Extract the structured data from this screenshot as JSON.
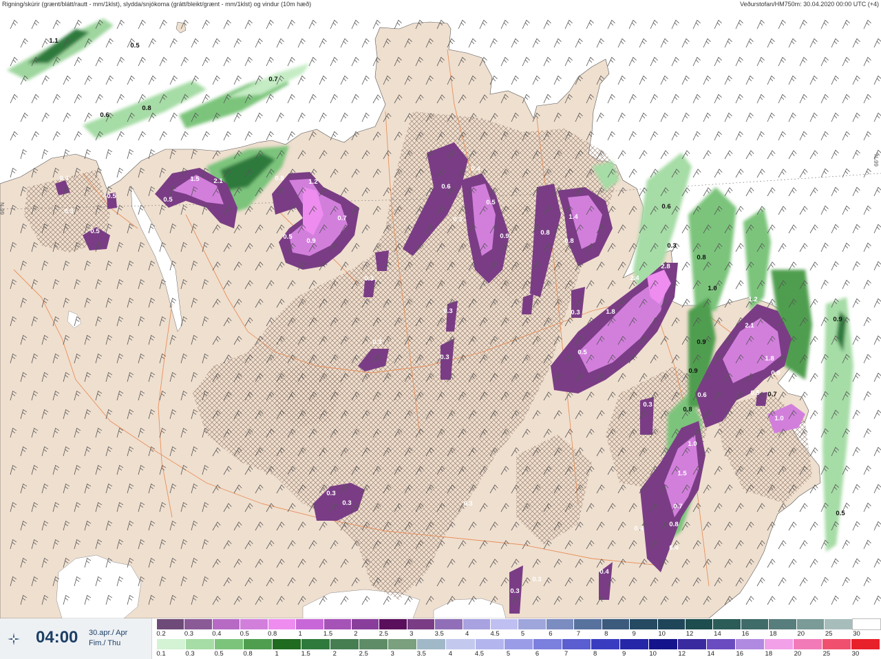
{
  "header": {
    "title": "Rigning/skúrir (grænt/blátt/rautt - mm/1klst), slydda/snjókoma (grátt/bleikt/grænt - mm/1klst) og vindur (10m hæð)",
    "source": "Veðurstofan/HM750m: 30.04.2020 00:00 UTC (+4)"
  },
  "time_panel": {
    "icon": "compass-spinner-icon",
    "time": "04:00",
    "date_line1": "30.apr./ Apr",
    "date_line2": "Fim./ Thu"
  },
  "map": {
    "land_color": "#efdfcf",
    "sea_color": "#ffffff",
    "road_color": "#e8905a",
    "latitude_label": "66°N",
    "precip_labels": [
      {
        "text": "1.1"
      },
      {
        "text": "0.5"
      },
      {
        "text": "0.7"
      },
      {
        "text": "0.8"
      },
      {
        "text": "0.6"
      },
      {
        "text": "0.4"
      },
      {
        "text": "0.5"
      },
      {
        "text": "0.3"
      },
      {
        "text": "0.5"
      },
      {
        "text": "1.5"
      },
      {
        "text": "2.1"
      },
      {
        "text": "0.5"
      },
      {
        "text": "1.2"
      },
      {
        "text": "0.8"
      },
      {
        "text": "0.7"
      },
      {
        "text": "0.5"
      },
      {
        "text": "0.9"
      },
      {
        "text": "0.6"
      },
      {
        "text": "0.4"
      },
      {
        "text": "0.3"
      },
      {
        "text": "0.5"
      },
      {
        "text": "0.9"
      },
      {
        "text": "0.8"
      },
      {
        "text": "1.4"
      },
      {
        "text": "0.8"
      },
      {
        "text": "0.6"
      },
      {
        "text": "0.3"
      },
      {
        "text": "2.4"
      },
      {
        "text": "2.8"
      },
      {
        "text": "1.8"
      },
      {
        "text": "0.3"
      },
      {
        "text": "0.5"
      },
      {
        "text": "0.8"
      },
      {
        "text": "1.0"
      },
      {
        "text": "0.9"
      },
      {
        "text": "1.2"
      },
      {
        "text": "2.1"
      },
      {
        "text": "1.8"
      },
      {
        "text": "0.9"
      },
      {
        "text": "0.9"
      },
      {
        "text": "0.6"
      },
      {
        "text": "0.7"
      },
      {
        "text": "0.8"
      },
      {
        "text": "1.0"
      },
      {
        "text": "0.3"
      },
      {
        "text": "1.0"
      },
      {
        "text": "1.5"
      },
      {
        "text": "0.7"
      },
      {
        "text": "0.4"
      },
      {
        "text": "0.8"
      },
      {
        "text": "0.4"
      },
      {
        "text": "0.3"
      },
      {
        "text": "0.3"
      },
      {
        "text": "0.3"
      },
      {
        "text": "0.3"
      },
      {
        "text": "0.4"
      },
      {
        "text": "0.3"
      },
      {
        "text": "0.3"
      },
      {
        "text": "0.5"
      },
      {
        "text": "0.9"
      },
      {
        "text": "0.5"
      },
      {
        "text": "0.3"
      },
      {
        "text": "0.3"
      },
      {
        "text": "0.3"
      }
    ]
  },
  "legend": {
    "snow_ticks": [
      "0.2",
      "0.3",
      "0.4",
      "0.5",
      "0.8",
      "1",
      "1.5",
      "2",
      "2.5",
      "3",
      "3.5",
      "4",
      "4.5",
      "5",
      "6",
      "7",
      "8",
      "9",
      "10",
      "12",
      "14",
      "16",
      "18",
      "20",
      "25",
      "30"
    ],
    "snow_colors": [
      "#6e4a78",
      "#8a5a96",
      "#b66ac4",
      "#d27fdc",
      "#ee8cf0",
      "#c868d8",
      "#a653b8",
      "#8a3e9c",
      "#5a0f5c",
      "#7a3d85",
      "#906fb8",
      "#a8a2e0",
      "#c0bff2",
      "#9fa6dc",
      "#7b8cc0",
      "#58729e",
      "#3b5a7c",
      "#254a62",
      "#1f4558",
      "#1d4d4e",
      "#2b5c58",
      "#3f6b68",
      "#577e7c",
      "#7a9b98",
      "#a7bdbc",
      "#ffffff"
    ],
    "rain_ticks": [
      "0.1",
      "0.3",
      "0.5",
      "0.8",
      "1",
      "1.5",
      "2",
      "2.5",
      "3",
      "3.5",
      "4",
      "4.5",
      "5",
      "6",
      "7",
      "8",
      "9",
      "10",
      "12",
      "14",
      "16",
      "18",
      "20",
      "25",
      "30"
    ],
    "rain_colors": [
      "#d4f2d4",
      "#a6dca6",
      "#7cc47c",
      "#4f9e4f",
      "#1f6b1f",
      "#2e7a3c",
      "#467e52",
      "#5e8c66",
      "#7aa07e",
      "#a1b8c8",
      "#c3c9ee",
      "#b3b6ee",
      "#9a9ce8",
      "#7b7fde",
      "#5a5ed0",
      "#3a3cc0",
      "#2626a8",
      "#14148c",
      "#3a2aa0",
      "#6a4bc0",
      "#b08ae0",
      "#f2a0e8",
      "#f27ab8",
      "#f0506e",
      "#e8202a"
    ]
  }
}
